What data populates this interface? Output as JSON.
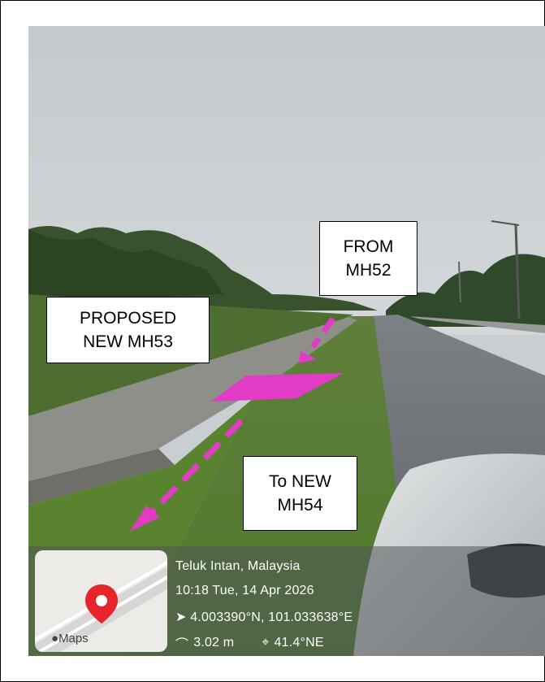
{
  "annotations": {
    "proposed_label": [
      "PROPOSED",
      "NEW MH53"
    ],
    "from_label": [
      "FROM",
      "MH52"
    ],
    "to_label": [
      "To NEW",
      "MH54"
    ],
    "arrow_color": "#e23bc6"
  },
  "geotag": {
    "location": "Teluk Intan, Malaysia",
    "datetime": "10:18 Tue, 14 Apr 2026",
    "coordinates": "4.003390°N, 101.033638°E",
    "altitude": "3.02 m",
    "heading": "41.4°NE",
    "map_brand": "Maps",
    "icons": [
      "location-arrow-icon",
      "altitude-icon",
      "compass-icon",
      "map-pin-icon",
      "apple-icon"
    ]
  }
}
